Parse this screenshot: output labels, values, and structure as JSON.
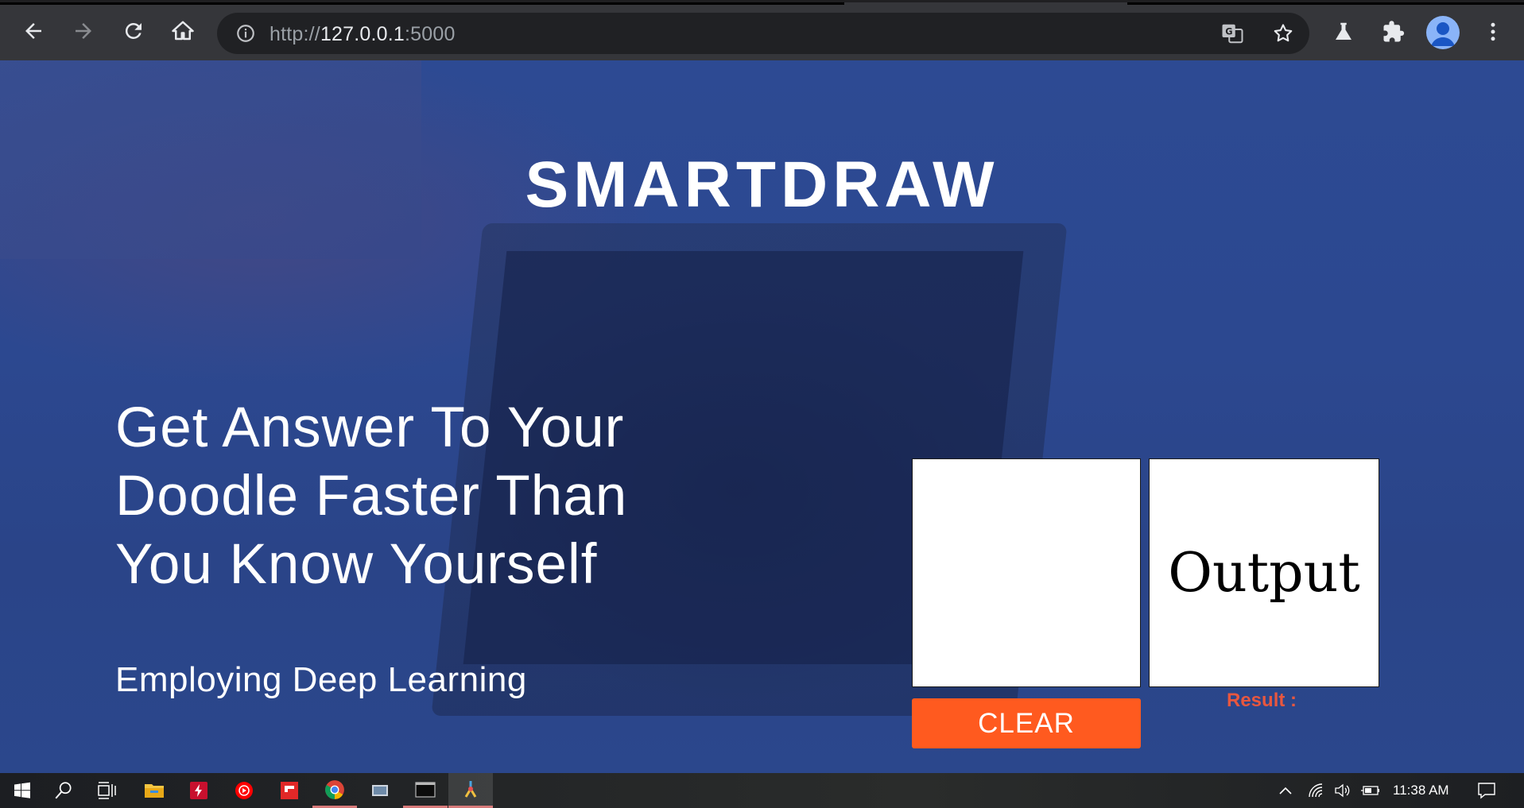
{
  "browser": {
    "url_scheme": "http://",
    "url_host": "127.0.0.1",
    "url_port": ":5000"
  },
  "page": {
    "brand": "SMARTDRAW",
    "headline_lines": [
      "Get Answer To Your",
      "Doodle Faster Than",
      "You Know Yourself"
    ],
    "subline": "Employing Deep Learning",
    "output_label": "Output",
    "clear_label": "CLEAR",
    "result_label": "Result :"
  },
  "taskbar": {
    "time": "11:38 AM"
  },
  "colors": {
    "accent": "#ff5a1f",
    "result": "#e8573f",
    "page_bg": "#2c4890"
  }
}
